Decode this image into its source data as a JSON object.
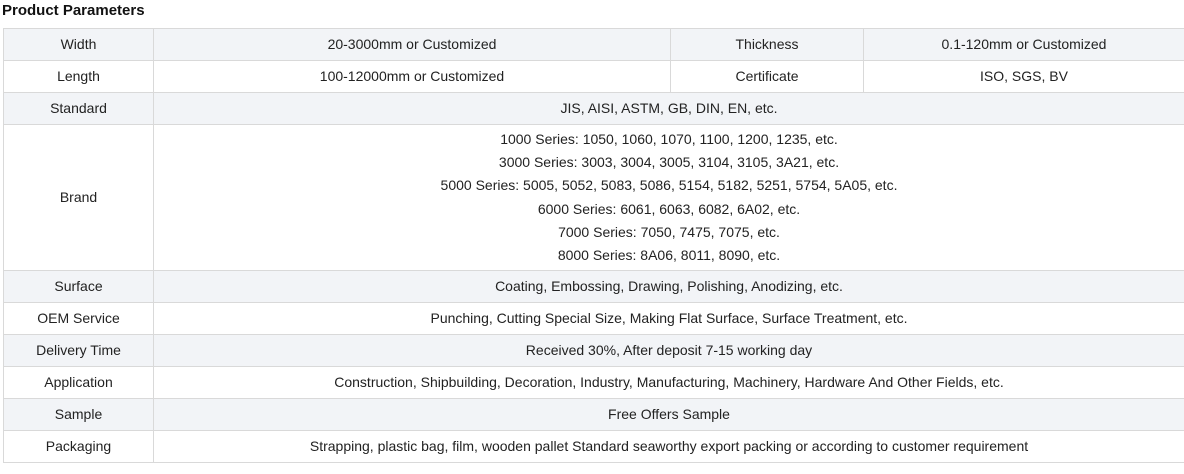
{
  "title": "Product Parameters",
  "rows": {
    "width": {
      "label": "Width",
      "value": "20-3000mm or Customized"
    },
    "thickness": {
      "label": "Thickness",
      "value": "0.1-120mm or Customized"
    },
    "length": {
      "label": "Length",
      "value": "100-12000mm or Customized"
    },
    "certificate": {
      "label": "Certificate",
      "value": "ISO, SGS, BV"
    },
    "standard": {
      "label": "Standard",
      "value": "JIS, AISI, ASTM, GB, DIN, EN, etc."
    },
    "brand": {
      "label": "Brand",
      "lines": [
        "1000 Series: 1050, 1060, 1070, 1100, 1200, 1235, etc.",
        "3000 Series: 3003, 3004, 3005, 3104, 3105, 3A21, etc.",
        "5000 Series: 5005, 5052, 5083, 5086, 5154, 5182, 5251, 5754, 5A05, etc.",
        "6000 Series: 6061, 6063, 6082, 6A02, etc.",
        "7000 Series: 7050, 7475, 7075, etc.",
        "8000 Series: 8A06, 8011, 8090, etc."
      ]
    },
    "surface": {
      "label": "Surface",
      "value": "Coating, Embossing, Drawing, Polishing, Anodizing, etc."
    },
    "oem": {
      "label": "OEM Service",
      "value": "Punching, Cutting Special Size, Making Flat Surface, Surface Treatment, etc."
    },
    "delivery": {
      "label": "Delivery Time",
      "value": "Received 30%, After deposit 7-15 working day"
    },
    "application": {
      "label": "Application",
      "value": "Construction, Shipbuilding, Decoration, Industry, Manufacturing, Machinery, Hardware And Other Fields, etc."
    },
    "sample": {
      "label": "Sample",
      "value": "Free Offers Sample"
    },
    "packaging": {
      "label": "Packaging",
      "value": "Strapping, plastic bag, film, wooden pallet Standard seaworthy export packing or according to customer requirement"
    }
  },
  "colors": {
    "row_shade": "#f2f4f7",
    "border": "#d9d9d9",
    "text": "#222222"
  }
}
